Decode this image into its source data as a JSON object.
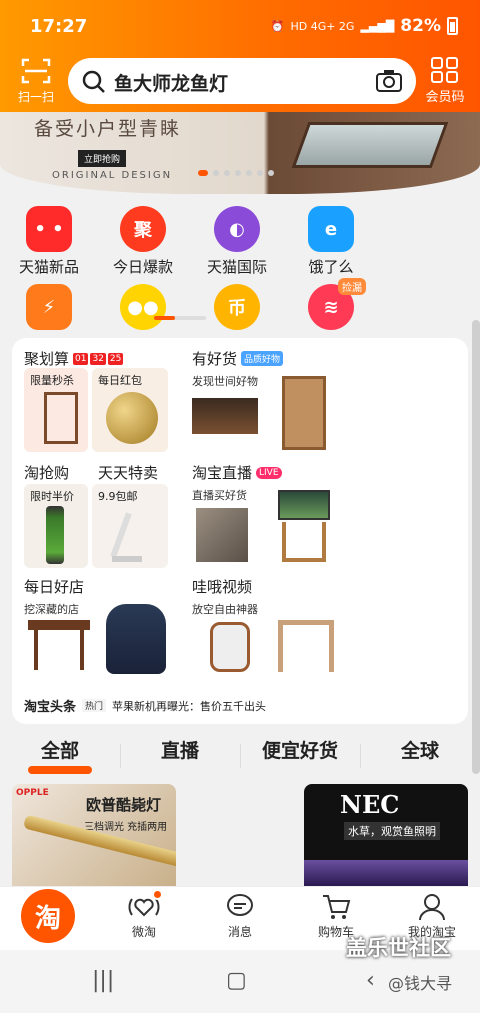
{
  "status": {
    "time": "17:27",
    "network": "HD 4G+ 2G",
    "battery": "82%"
  },
  "header": {
    "scan_label": "扫一扫",
    "search_text": "鱼大师龙鱼灯",
    "member_label": "会员码"
  },
  "banner": {
    "slogan": "备受小户型青睐",
    "button": "立即抢购",
    "design": "ORIGINAL DESIGN"
  },
  "icons": [
    {
      "label": "天猫新品",
      "icon": "tmall-cat-icon",
      "color": "#ff2a2a"
    },
    {
      "label": "今日爆款",
      "icon": "ju-icon",
      "color": "#ff3b1f"
    },
    {
      "label": "天猫国际",
      "icon": "planet-icon",
      "color": "#8a4bd8"
    },
    {
      "label": "饿了么",
      "icon": "eleme-icon",
      "color": "#1aa1ff"
    }
  ],
  "icons_row2": [
    {
      "icon": "bolt-icon",
      "color": "#ff7a1a",
      "badge": ""
    },
    {
      "icon": "chick-icon",
      "color": "#ffd400",
      "badge": ""
    },
    {
      "icon": "coin-icon",
      "color": "#ffb400",
      "badge": ""
    },
    {
      "icon": "gift-icon",
      "color": "#ff3a55",
      "badge": "捡漏"
    }
  ],
  "sections": {
    "juhuasuan": {
      "title": "聚划算",
      "timer": [
        "01",
        "32",
        "25"
      ],
      "items": [
        "限量秒杀",
        "每日红包"
      ]
    },
    "youhaohuo": {
      "title": "有好货",
      "tag": "品质好物",
      "sub": "发现世间好物"
    },
    "taoqianggou": {
      "title": "淘抢购",
      "sub": "限时半价"
    },
    "tiantian": {
      "title": "天天特卖",
      "sub": "9.9包邮"
    },
    "zhibo": {
      "title": "淘宝直播",
      "tag": "LIVE",
      "sub": "直播买好货"
    },
    "meiri": {
      "title": "每日好店",
      "sub": "挖深藏的店"
    },
    "waoshipin": {
      "title": "哇哦视频",
      "sub": "放空自由神器"
    },
    "toutiao": {
      "title": "淘宝头条",
      "tag": "热门",
      "text": "苹果新机再曝光：售价五千出头"
    }
  },
  "tabs": [
    "全部",
    "直播",
    "便宜好货",
    "全球"
  ],
  "feed": [
    {
      "brand": "OPPLE",
      "title": "欧普酷毙灯",
      "sub": "三档调光 充插两用"
    },
    {
      "brand": "NEC",
      "sub": "水草，观赏鱼照明"
    }
  ],
  "bottom_nav": [
    "淘",
    "微淘",
    "消息",
    "购物车",
    "我的淘宝"
  ],
  "watermark": "盖乐世社区",
  "watermark2": "@钱大寻"
}
